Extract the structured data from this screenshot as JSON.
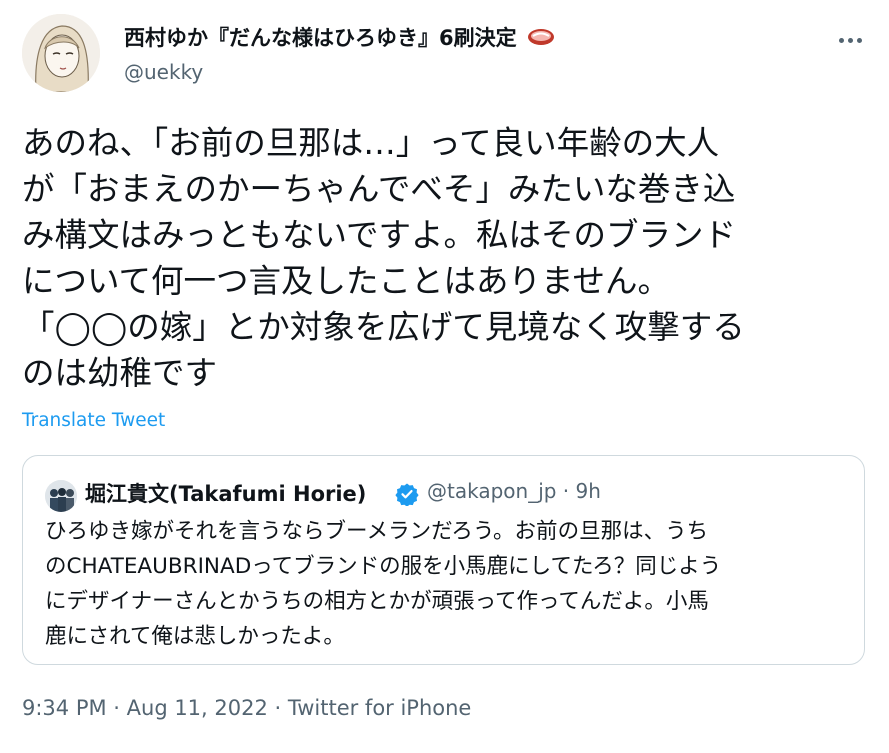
{
  "author": {
    "name": "西村ゆか『だんな様はひろゆき』6刷決定",
    "name_emoji": "meat-emoji",
    "handle": "@uekky",
    "avatar_icon": "avatar-illustration"
  },
  "more_icon": "more-options-icon",
  "tweet_lines": [
    "あのね、「お前の旦那は…」って良い年齢の大人",
    "が「おまえのかーちゃんでべそ」みたいな巻き込",
    "み構文はみっともないですよ。私はそのブランド",
    "について何一つ言及したことはありません。",
    "「◯◯の嫁」とか対象を広げて見境なく攻撃する",
    "のは幼稚です"
  ],
  "translate_label": "Translate Tweet",
  "quoted": {
    "name": "堀江貴文(Takafumi Horie)",
    "verified_icon": "verified-badge-icon",
    "handle_time": "@takapon_jp · 9h",
    "text_lines": [
      "ひろゆき嫁がそれを言うならブーメランだろう。お前の旦那は、うち",
      "のCHATEAUBRINADってブランドの服を小馬鹿にしてたろ？同じよう",
      "にデザイナーさんとかうちの相方とかが頑張って作ってんだよ。小馬",
      "鹿にされて俺は悲しかったよ。"
    ]
  },
  "timestamp": "9:34 PM · Aug 11, 2022 · Twitter for iPhone",
  "colors": {
    "text": "#0f1419",
    "secondary": "#536471",
    "link": "#1d9bf0",
    "border": "#cfd9de"
  }
}
